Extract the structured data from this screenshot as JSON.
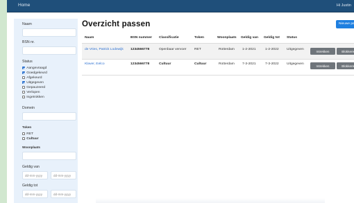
{
  "header": {
    "home": "Home",
    "user": "Hi Justin"
  },
  "sidebar": {
    "naam_label": "Naam",
    "bsn_label": "BSN nr.",
    "status_label": "Status",
    "status_options": [
      {
        "label": "Aangevraagd",
        "checked": true
      },
      {
        "label": "Goedgekeurd",
        "checked": true
      },
      {
        "label": "Afgekeurd",
        "checked": false
      },
      {
        "label": "Uitgegeven",
        "checked": true
      },
      {
        "label": "Gepauzeerd",
        "checked": false
      },
      {
        "label": "Verlopen",
        "checked": false
      },
      {
        "label": "Ingetrokken",
        "checked": false
      }
    ],
    "domein_label": "Domein",
    "token_label": "Token",
    "token_options": [
      {
        "label": "RET",
        "checked": false
      },
      {
        "label": "Cultuur",
        "checked": false
      }
    ],
    "woonplaats_label": "Woonplaats",
    "geldig_van_label": "Geldig van",
    "geldig_tot_label": "Geldig tot",
    "date_placeholder": "dd-mm-yyyy"
  },
  "main": {
    "title": "Overzicht  passen",
    "new_button": "Nieuwe pas"
  },
  "table": {
    "columns": [
      "Naam",
      "BSN nummer",
      "Classificatie",
      "Token",
      "Woonplaats",
      "Geldig van",
      "Geldig tot",
      "Status"
    ],
    "rows": [
      {
        "naam": "de Vries, Patrick Lodewijk",
        "bsn": "1234566778",
        "classificatie": "Openbaar vervoer",
        "token": "RET",
        "woonplaats": "Rotterdam",
        "geldig_van": "1-2-2021",
        "geldig_tot": "1-2-2022",
        "status": "Uitgegeven"
      },
      {
        "naam": "Klaver, Eelco",
        "bsn": "1234566778",
        "classificatie": "Cultuur",
        "token": "Cultuur",
        "woonplaats": "Rotterdam",
        "geldig_van": "7-3-2021",
        "geldig_tot": "7-3-2022",
        "status": "Uitgegeven"
      }
    ],
    "action_intrekken": "Intrekken",
    "action_blokkeren": "Blokkeren"
  }
}
